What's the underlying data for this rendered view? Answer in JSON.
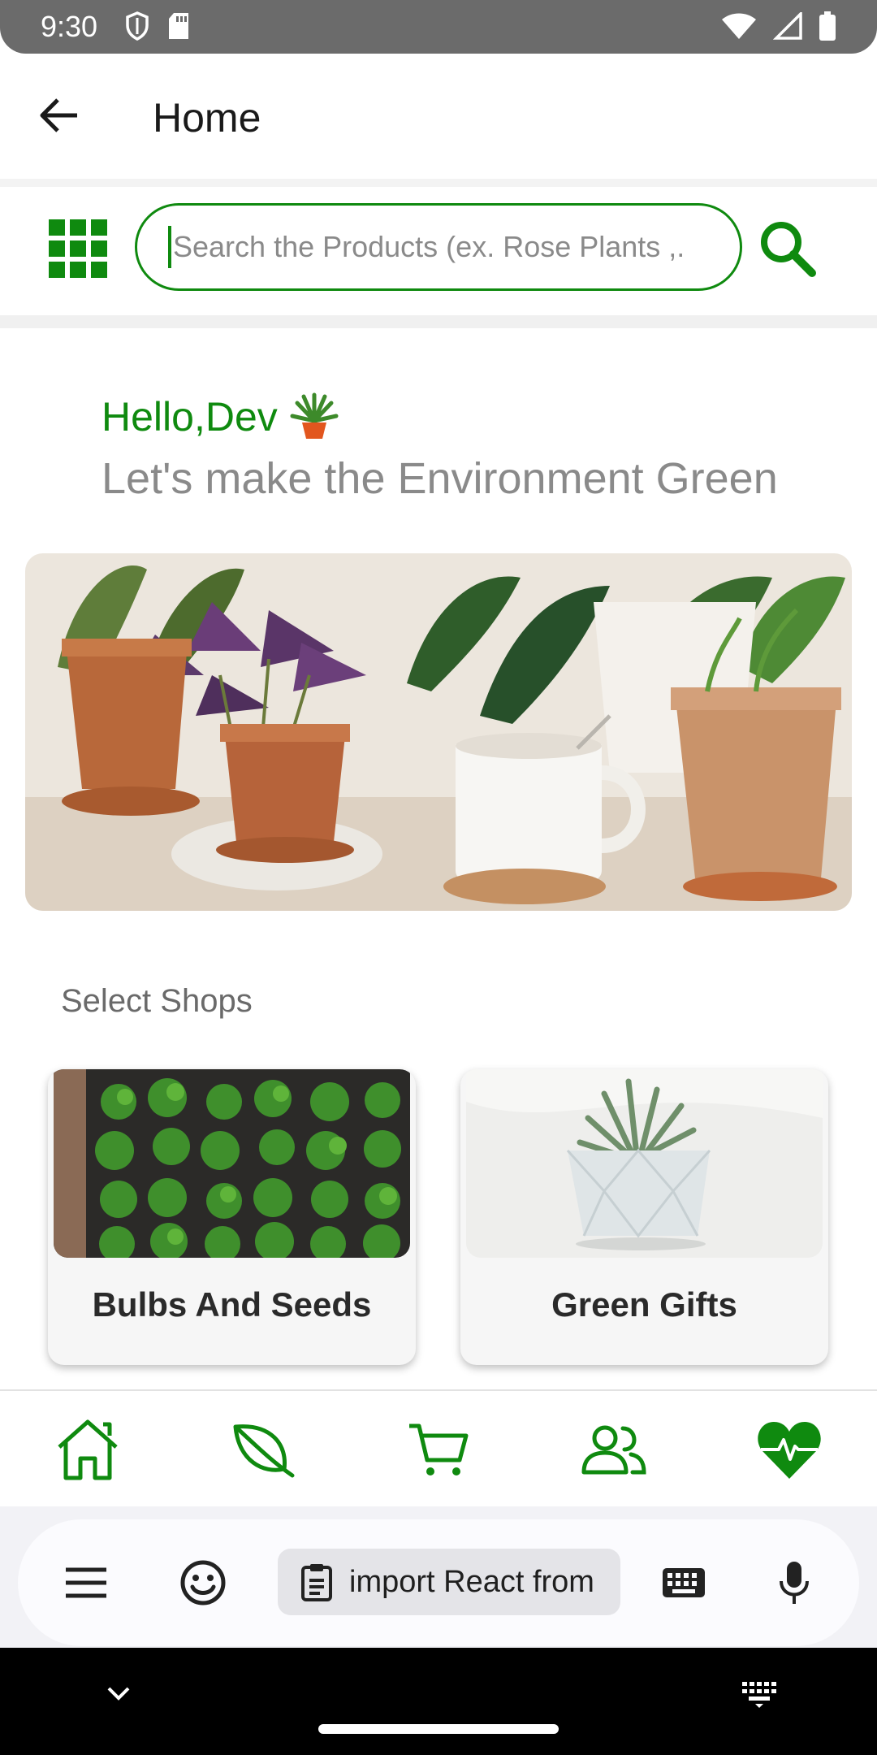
{
  "status_bar": {
    "time": "9:30"
  },
  "app_bar": {
    "title": "Home"
  },
  "search": {
    "placeholder": "Search the Products (ex. Rose Plants ,."
  },
  "greeting": {
    "name": "Hello,Dev",
    "subtitle": "Let's make the Environment Green"
  },
  "shops": {
    "title": "Select Shops",
    "items": [
      {
        "label": "Bulbs And Seeds"
      },
      {
        "label": "Green Gifts"
      }
    ]
  },
  "bottom_nav": {
    "items": [
      "home-icon",
      "leaf-icon",
      "cart-icon",
      "users-icon",
      "health-icon"
    ],
    "accent": "#0f8a0f"
  },
  "keyboard_toolbar": {
    "clipboard_text": "import React from"
  },
  "colors": {
    "accent": "#0f8a0f",
    "status_bar": "#6b6b6b"
  }
}
